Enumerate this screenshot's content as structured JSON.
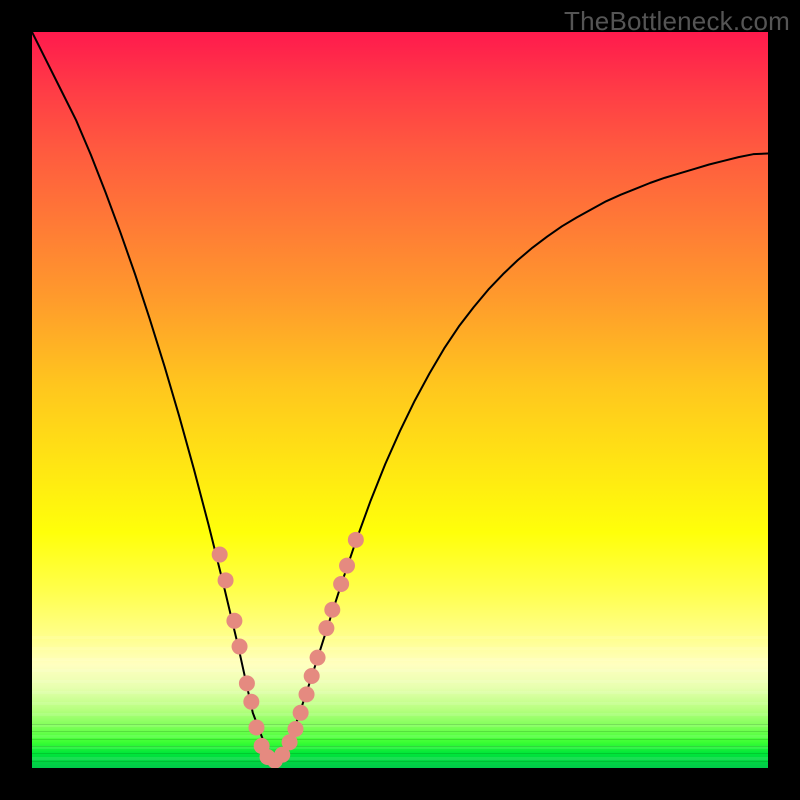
{
  "watermark": "TheBottleneck.com",
  "colors": {
    "background": "#000000",
    "curve": "#000000",
    "markers": "#e58a80",
    "watermark": "#555555"
  },
  "chart_data": {
    "type": "line",
    "title": "",
    "xlabel": "",
    "ylabel": "",
    "xlim": [
      0,
      100
    ],
    "ylim": [
      0,
      100
    ],
    "grid": false,
    "annotations": [
      "TheBottleneck.com"
    ],
    "x": [
      0,
      2,
      4,
      6,
      8,
      10,
      12,
      14,
      16,
      18,
      20,
      22,
      24,
      26,
      28,
      30,
      32,
      32.5,
      33,
      34,
      35,
      36,
      38,
      40,
      42,
      44,
      46,
      48,
      50,
      52,
      54,
      56,
      58,
      60,
      62,
      64,
      66,
      68,
      70,
      72,
      74,
      76,
      78,
      80,
      82,
      84,
      86,
      88,
      90,
      92,
      94,
      96,
      98,
      100
    ],
    "y": [
      100,
      96,
      92,
      88,
      83.3,
      78.2,
      72.8,
      67.1,
      61,
      54.6,
      47.8,
      40.6,
      33,
      25,
      16.6,
      7.5,
      2.2,
      1,
      1,
      2,
      3.8,
      6.4,
      12.4,
      18.7,
      24.9,
      30.8,
      36.3,
      41.3,
      45.8,
      49.9,
      53.6,
      57,
      60,
      62.6,
      65,
      67.1,
      69,
      70.7,
      72.2,
      73.6,
      74.8,
      75.9,
      77,
      77.9,
      78.7,
      79.5,
      80.2,
      80.8,
      81.4,
      82,
      82.5,
      83,
      83.4,
      83.5
    ],
    "markers": {
      "note": "Highlighted data points along the curve (salmon-colored dots).",
      "points": [
        {
          "x": 25.5,
          "y": 29.0
        },
        {
          "x": 26.3,
          "y": 25.5
        },
        {
          "x": 27.5,
          "y": 20.0
        },
        {
          "x": 28.2,
          "y": 16.5
        },
        {
          "x": 29.2,
          "y": 11.5
        },
        {
          "x": 29.8,
          "y": 9.0
        },
        {
          "x": 30.5,
          "y": 5.5
        },
        {
          "x": 31.2,
          "y": 3.0
        },
        {
          "x": 32.0,
          "y": 1.5
        },
        {
          "x": 33.0,
          "y": 1.0
        },
        {
          "x": 34.0,
          "y": 1.8
        },
        {
          "x": 35.0,
          "y": 3.5
        },
        {
          "x": 35.8,
          "y": 5.3
        },
        {
          "x": 36.5,
          "y": 7.5
        },
        {
          "x": 37.3,
          "y": 10.0
        },
        {
          "x": 38.0,
          "y": 12.5
        },
        {
          "x": 38.8,
          "y": 15.0
        },
        {
          "x": 40.0,
          "y": 19.0
        },
        {
          "x": 40.8,
          "y": 21.5
        },
        {
          "x": 42.0,
          "y": 25.0
        },
        {
          "x": 42.8,
          "y": 27.5
        },
        {
          "x": 44.0,
          "y": 31.0
        }
      ]
    }
  }
}
